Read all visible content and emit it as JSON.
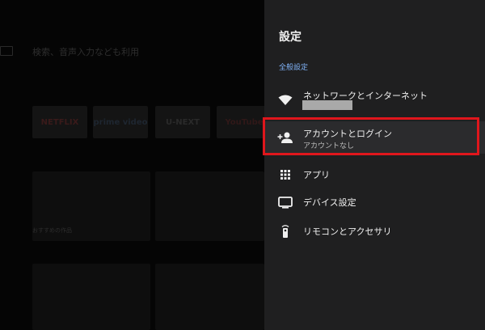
{
  "background": {
    "search_hint": "検索、音声入力なども利用",
    "apps": [
      "NETFLIX",
      "prime video",
      "U-NEXT",
      "YouTube"
    ],
    "card_label": "おすすめの作品"
  },
  "settings_panel": {
    "title": "設定",
    "section_label": "全般設定",
    "items": [
      {
        "label": "ネットワークとインターネット",
        "sub": "",
        "icon": "wifi-icon"
      },
      {
        "label": "アカウントとログイン",
        "sub": "アカウントなし",
        "icon": "add-person-icon"
      },
      {
        "label": "アプリ",
        "sub": "",
        "icon": "apps-grid-icon"
      },
      {
        "label": "デバイス設定",
        "sub": "",
        "icon": "tv-icon"
      },
      {
        "label": "リモコンとアクセサリ",
        "sub": "",
        "icon": "remote-icon"
      }
    ]
  },
  "colors": {
    "panel_bg": "#1f1f20",
    "section_accent": "#7fb1f5",
    "highlight_border": "#e0161c"
  }
}
